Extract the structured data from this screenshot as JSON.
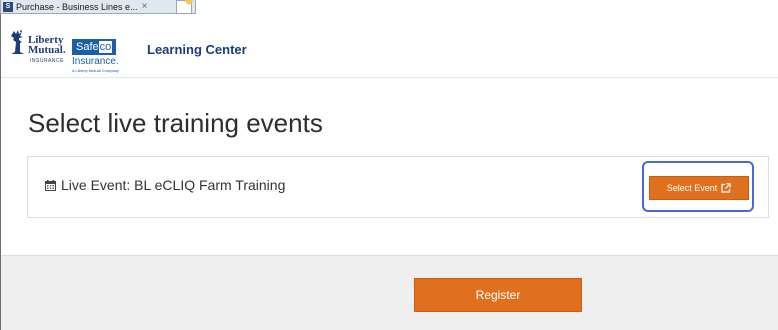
{
  "browser": {
    "tab_title": "Purchase - Business Lines e...",
    "tab_close": "×",
    "favicon_text": "S"
  },
  "header": {
    "liberty_mutual_line1": "Liberty",
    "liberty_mutual_line2": "Mutual.",
    "liberty_mutual_sub": "INSURANCE",
    "safeco_safe": "Safe",
    "safeco_co": "co",
    "safeco_insurance": "Insurance.",
    "safeco_tagline": "A Liberty Mutual Company",
    "site_title": "Learning Center"
  },
  "main": {
    "heading": "Select live training events",
    "events": [
      {
        "label": "Live Event: BL eCLIQ Farm Training",
        "icon": "calendar-icon",
        "button_label": "Select Event",
        "button_icon": "external-link-icon"
      }
    ]
  },
  "footer": {
    "register_label": "Register"
  },
  "colors": {
    "accent_orange": "#e0701e",
    "brand_blue": "#1b3d7a",
    "highlight_blue": "#4a66e0"
  }
}
